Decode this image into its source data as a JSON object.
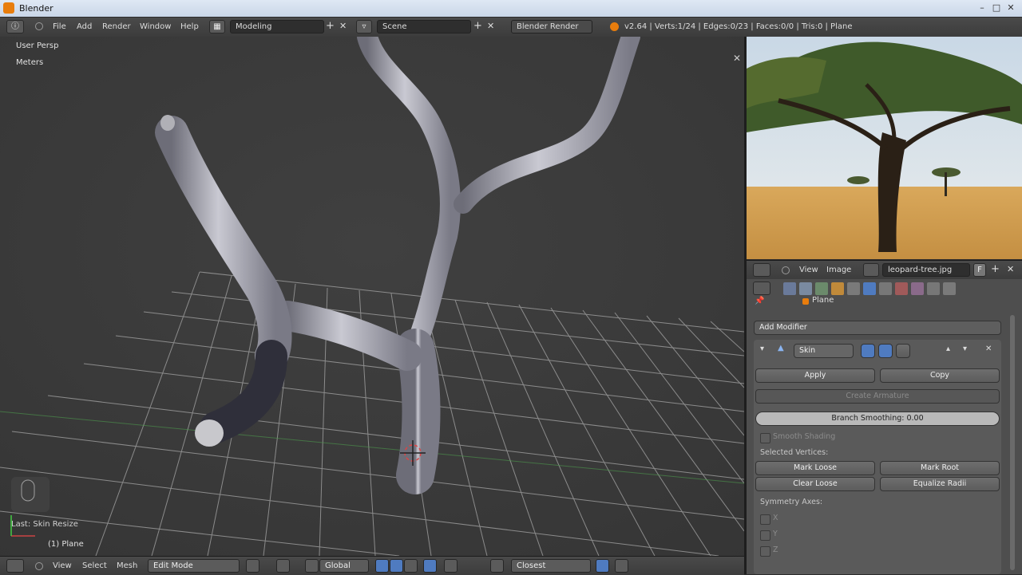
{
  "window": {
    "title": "Blender",
    "controls": [
      "–",
      "□",
      "✕"
    ]
  },
  "info_header": {
    "menus": [
      "File",
      "Add",
      "Render",
      "Window",
      "Help"
    ],
    "screen_layout": "Modeling",
    "scene": "Scene",
    "render_engine": "Blender Render",
    "stats": "v2.64 | Verts:1/24 | Edges:0/23 | Faces:0/0 | Tris:0 | Plane"
  },
  "viewport": {
    "view_name": "User Persp",
    "units": "Meters",
    "last_operator": "Last: Skin Resize",
    "object_label": "(1) Plane"
  },
  "bottom_header": {
    "menus": [
      "View",
      "Select",
      "Mesh"
    ],
    "mode": "Edit Mode",
    "orientation": "Global",
    "snap_target": "Closest"
  },
  "image_editor": {
    "menus": [
      "View",
      "Image"
    ],
    "image_name": "leopard-tree.jpg",
    "pin_label": "F"
  },
  "properties": {
    "object_name": "Plane",
    "add_modifier": "Add Modifier",
    "modifier_name": "Skin",
    "apply_label": "Apply",
    "copy_label": "Copy",
    "create_armature_label": "Create Armature",
    "branch_smoothing": "Branch Smoothing: 0.00",
    "smooth_shading_label": "Smooth Shading",
    "selected_vertices_label": "Selected Vertices:",
    "mark_loose_label": "Mark Loose",
    "mark_root_label": "Mark Root",
    "clear_loose_label": "Clear Loose",
    "equalize_radii_label": "Equalize Radii",
    "symmetry_axes_label": "Symmetry Axes:",
    "axes": [
      "X",
      "Y",
      "Z"
    ]
  },
  "colors": {
    "accent": "#4f7bc0",
    "background": "#3b3b3b",
    "panel": "#5a5a5a",
    "blender_orange": "#e87d0d"
  }
}
